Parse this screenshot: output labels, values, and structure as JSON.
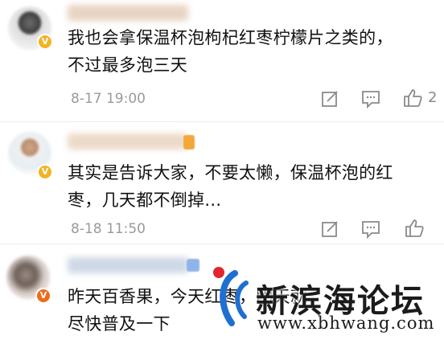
{
  "comments": [
    {
      "text_line1": "我也会拿保温杯泡枸杞红枣柠檬片之类的，",
      "text_line2": "不过最多泡三天",
      "time": "8-17 19:00",
      "likes": "2",
      "badge": "V"
    },
    {
      "text_line1": "其实是告诉大家，不要太懒，保温杯泡的红",
      "text_line2": "枣，几天都不倒掉...",
      "time": "8-18 11:50",
      "likes": "",
      "badge": "V"
    },
    {
      "text_line1": "昨天百香果，今天红枣，明天就",
      "text_line2": "尽快普及一下",
      "badge": "V"
    }
  ],
  "watermark": {
    "title": "新滨海论坛",
    "url": "www.xbhwang.com"
  },
  "colors": {
    "badge_gold": "#f3b323",
    "badge_orange": "#ee6b1a",
    "watermark_blue": "#1f6fd1",
    "watermark_red": "#e2252e",
    "meta_gray": "#9a9a9a"
  },
  "icons": [
    "edit-icon",
    "comment-icon",
    "like-icon"
  ]
}
